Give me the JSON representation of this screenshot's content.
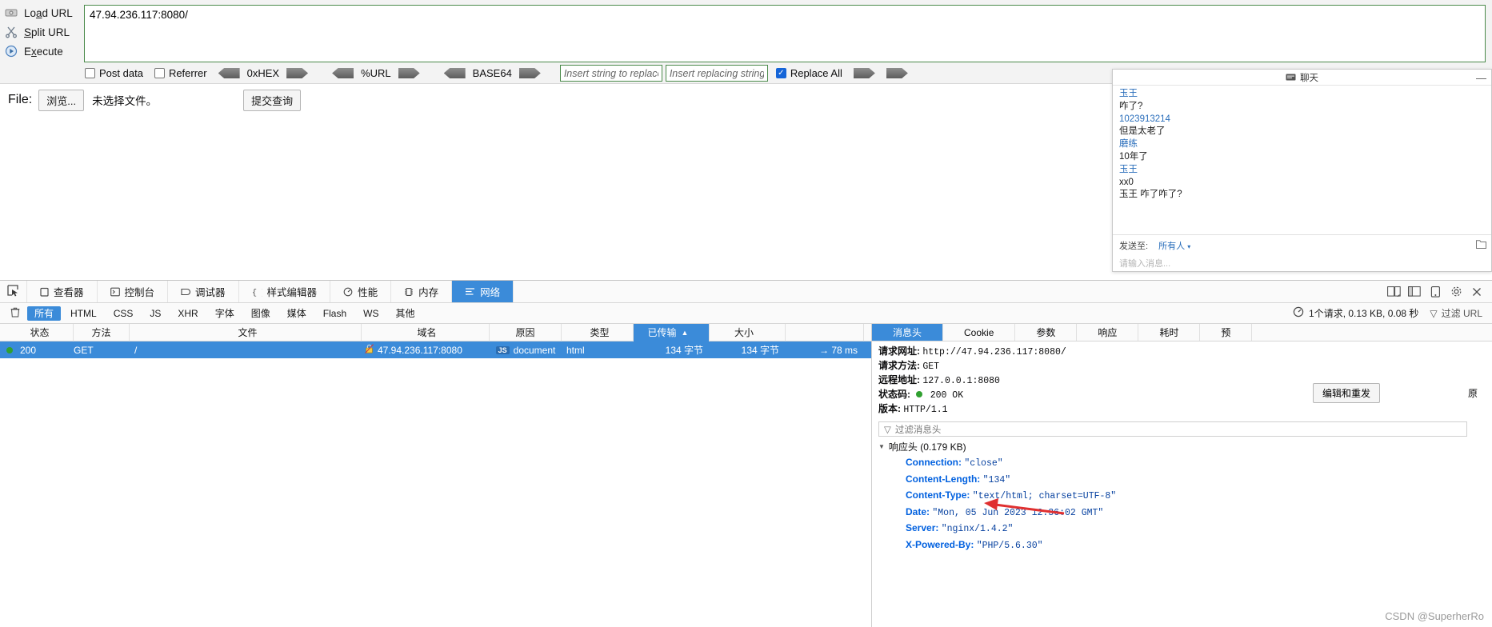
{
  "hackbar": {
    "actions": [
      {
        "label_pre": "Lo",
        "label_key": "a",
        "label_post": "d URL",
        "full": "Load URL",
        "icon": "load-url-icon"
      },
      {
        "label_pre": "",
        "label_key": "S",
        "label_post": "plit URL",
        "full": "Split URL",
        "icon": "split-url-icon"
      },
      {
        "label_pre": "E",
        "label_key": "x",
        "label_post": "ecute",
        "full": "Execute",
        "icon": "execute-icon"
      }
    ],
    "url_value": "47.94.236.117:8080/",
    "checkboxes": [
      {
        "label": "Post data",
        "checked": false
      },
      {
        "label": "Referrer",
        "checked": false
      }
    ],
    "encoders": [
      "0xHEX",
      "%URL",
      "BASE64"
    ],
    "replace_find_placeholder": "Insert string to replace",
    "replace_with_placeholder": "Insert replacing string",
    "replace_all_label": "Replace All",
    "replace_all_checked": true
  },
  "file_row": {
    "label": "File:",
    "browse_button": "浏览...",
    "file_status": "未选择文件。",
    "submit_button": "提交查询"
  },
  "chat": {
    "title": "聊天",
    "minimize": "—",
    "messages": [
      {
        "type": "name",
        "text": "玉王"
      },
      {
        "type": "msg",
        "text": "咋了?"
      },
      {
        "type": "name",
        "text": "1023913214"
      },
      {
        "type": "msg",
        "text": "但是太老了"
      },
      {
        "type": "name",
        "text": "磨练"
      },
      {
        "type": "msg",
        "text": "10年了"
      },
      {
        "type": "name",
        "text": "玉王"
      },
      {
        "type": "msg",
        "text": "xx0"
      },
      {
        "type": "msg",
        "text": "玉王 咋了咋了?"
      }
    ],
    "send_to_label": "发送至:",
    "send_to_value": "所有人",
    "input_placeholder": "请输入消息..."
  },
  "devtools": {
    "tabs": [
      {
        "label": "查看器",
        "icon": "inspector-icon",
        "selected": false
      },
      {
        "label": "控制台",
        "icon": "console-icon",
        "selected": false
      },
      {
        "label": "调试器",
        "icon": "debugger-icon",
        "selected": false
      },
      {
        "label": "样式编辑器",
        "icon": "style-editor-icon",
        "selected": false
      },
      {
        "label": "性能",
        "icon": "performance-icon",
        "selected": false
      },
      {
        "label": "内存",
        "icon": "memory-icon",
        "selected": false
      },
      {
        "label": "网络",
        "icon": "network-icon",
        "selected": true
      }
    ],
    "picker_icon": "element-picker-icon",
    "right_icons": [
      "responsive-layout-icon",
      "dock-side-icon",
      "screenshot-icon",
      "settings-gear-icon",
      "close-icon"
    ],
    "filters": [
      {
        "label": "所有",
        "selected": true
      },
      {
        "label": "HTML",
        "selected": false
      },
      {
        "label": "CSS",
        "selected": false
      },
      {
        "label": "JS",
        "selected": false
      },
      {
        "label": "XHR",
        "selected": false
      },
      {
        "label": "字体",
        "selected": false
      },
      {
        "label": "图像",
        "selected": false
      },
      {
        "label": "媒体",
        "selected": false
      },
      {
        "label": "Flash",
        "selected": false
      },
      {
        "label": "WS",
        "selected": false
      },
      {
        "label": "其他",
        "selected": false
      }
    ],
    "trash_icon": "trash-icon",
    "summary_icon": "no-throttling-icon",
    "summary_text": "1个请求, 0.13 KB, 0.08 秒",
    "url_filter_icon": "funnel-icon",
    "url_filter_placeholder": "过滤 URL",
    "columns": [
      {
        "label": "状态",
        "selected": false
      },
      {
        "label": "方法",
        "selected": false
      },
      {
        "label": "文件",
        "selected": false
      },
      {
        "label": "域名",
        "selected": false
      },
      {
        "label": "原因",
        "selected": false
      },
      {
        "label": "类型",
        "selected": false
      },
      {
        "label": "已传输",
        "selected": true,
        "sort": "▲"
      },
      {
        "label": "大小",
        "selected": false
      },
      {
        "label": "",
        "selected": false
      }
    ],
    "rows": [
      {
        "status": "200",
        "method": "GET",
        "file": "/",
        "domain": "47.94.236.117:8080",
        "domain_icon": "lock-warning-icon",
        "cause_badge": "JS",
        "cause": "document",
        "type": "html",
        "transferred": "134 字节",
        "size": "134 字节",
        "time": "→ 78 ms"
      }
    ],
    "detail_tabs": [
      {
        "label": "消息头",
        "selected": true
      },
      {
        "label": "Cookie",
        "selected": false
      },
      {
        "label": "参数",
        "selected": false
      },
      {
        "label": "响应",
        "selected": false
      },
      {
        "label": "耗时",
        "selected": false
      },
      {
        "label": "预",
        "selected": false
      }
    ],
    "detail": {
      "request_url_label": "请求网址:",
      "request_url_value": "http://47.94.236.117:8080/",
      "request_method_label": "请求方法:",
      "request_method_value": "GET",
      "remote_addr_label": "远程地址:",
      "remote_addr_value": "127.0.0.1:8080",
      "status_label": "状态码:",
      "status_value": "200 OK",
      "version_label": "版本:",
      "version_value": "HTTP/1.1",
      "resend_button": "编辑和重发",
      "raw_label": "原",
      "filter_placeholder": "过滤消息头",
      "response_section": "响应头 (0.179 KB)",
      "headers": [
        {
          "key": "Connection:",
          "value": "\"close\""
        },
        {
          "key": "Content-Length:",
          "value": "\"134\""
        },
        {
          "key": "Content-Type:",
          "value": "\"text/html; charset=UTF-8\""
        },
        {
          "key": "Date:",
          "value": "\"Mon, 05 Jun 2023 12:36:02 GMT\""
        },
        {
          "key": "Server:",
          "value": "\"nginx/1.4.2\""
        },
        {
          "key": "X-Powered-By:",
          "value": "\"PHP/5.6.30\""
        }
      ]
    }
  },
  "watermark": "CSDN @SuperherRo",
  "colors": {
    "accent_blue": "#3b8bd9",
    "link_blue": "#2a6ebb",
    "header_key": "#0060df",
    "header_value": "#0842a0",
    "green_border": "#4a8a4a",
    "annotation_red": "#e03030"
  }
}
